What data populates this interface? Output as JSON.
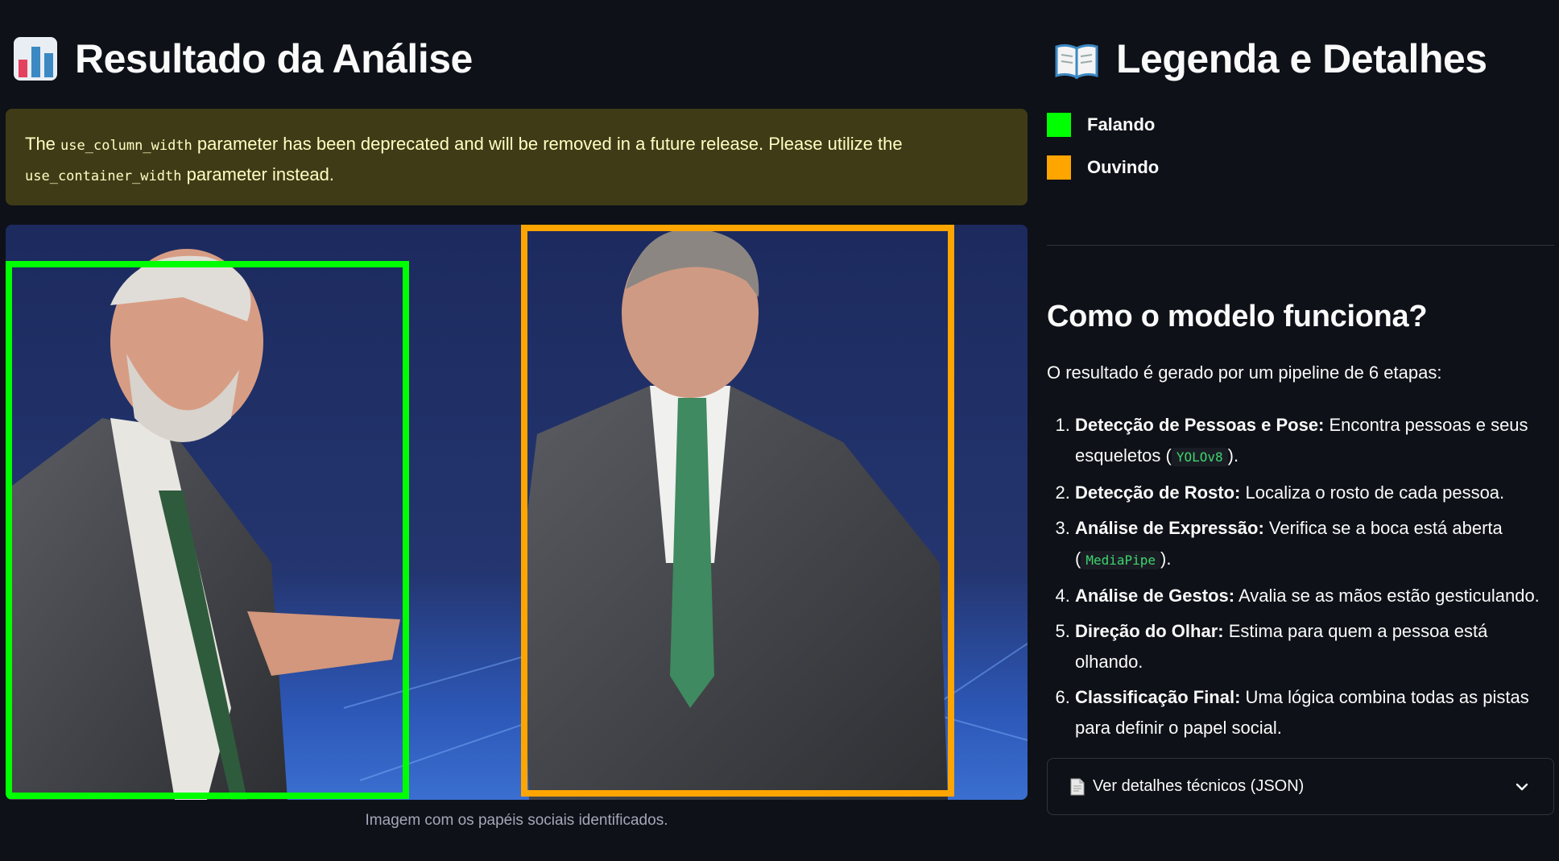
{
  "left": {
    "title": "Resultado da Análise",
    "title_icon": "bar-chart-icon",
    "warning": {
      "text_1": "The ",
      "code_1": "use_column_width",
      "text_2": " parameter has been deprecated and will be removed in a future release. Please utilize the ",
      "code_2": "use_container_width",
      "text_3": " parameter instead."
    },
    "image_caption": "Imagem com os papéis sociais identificados."
  },
  "right": {
    "title": "Legenda e Detalhes",
    "title_icon": "open-book-icon",
    "legend": [
      {
        "label": "Falando",
        "color": "#00ff00"
      },
      {
        "label": "Ouvindo",
        "color": "#ffa500"
      }
    ],
    "how_title": "Como o modelo funciona?",
    "intro": "O resultado é gerado por um pipeline de 6 etapas:",
    "steps": [
      {
        "bold": "Detecção de Pessoas e Pose:",
        "text": " Encontra pessoas e seus esqueletos (",
        "code": "YOLOv8",
        "after": ")."
      },
      {
        "bold": "Detecção de Rosto:",
        "text": " Localiza o rosto de cada pessoa."
      },
      {
        "bold": "Análise de Expressão:",
        "text": " Verifica se a boca está aberta (",
        "code": "MediaPipe",
        "after": ")."
      },
      {
        "bold": "Análise de Gestos:",
        "text": " Avalia se as mãos estão gesticulando."
      },
      {
        "bold": "Direção do Olhar:",
        "text": " Estima para quem a pessoa está olhando."
      },
      {
        "bold": "Classificação Final:",
        "text": " Uma lógica combina todas as pistas para definir o papel social."
      }
    ],
    "expander_label": "Ver detalhes técnicos (JSON)",
    "expander_icon": "document-icon"
  },
  "colors": {
    "speaking": "#00ff00",
    "listening": "#ffa500",
    "background": "#0e1117",
    "warning_bg": "#3f3b17"
  }
}
